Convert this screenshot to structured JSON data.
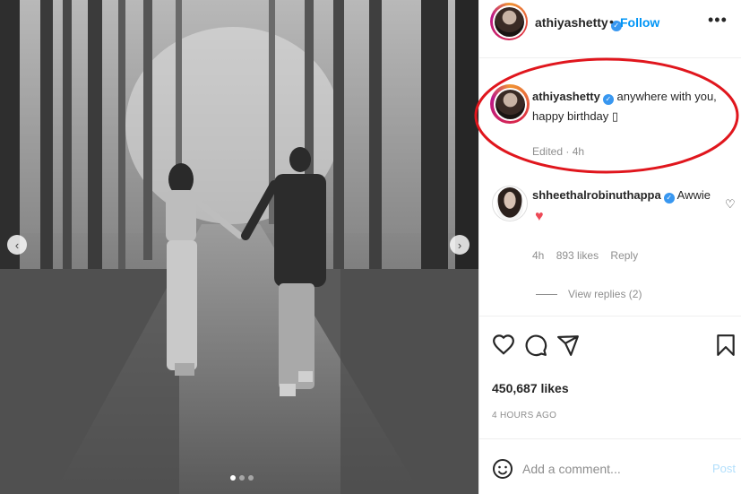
{
  "post": {
    "username": "athiyashetty",
    "follow_label": "Follow",
    "separator": "•",
    "more_label": "•••",
    "carousel_prev": "‹",
    "carousel_next": "›",
    "carousel_count": 3,
    "carousel_active": 1
  },
  "caption": {
    "username": "athiyashetty",
    "text": "anywhere with you, happy birthday ▯",
    "meta": "Edited · 4h"
  },
  "comment": {
    "username": "shheethalrobinuthappa",
    "text": "Awwie",
    "heart": "♥",
    "like_icon": "♡",
    "age": "4h",
    "likes": "893 likes",
    "reply": "Reply",
    "view_replies": "View replies (2)"
  },
  "stats": {
    "likes": "450,687 likes",
    "time": "4 HOURS AGO"
  },
  "composer": {
    "placeholder": "Add a comment...",
    "post_label": "Post"
  },
  "colors": {
    "accent": "#0095f6",
    "heart": "#ed4956",
    "annotation": "#e0161d"
  },
  "icons": [
    "verified-icon",
    "heart-icon",
    "comment-icon",
    "share-icon",
    "bookmark-icon",
    "emoji-icon",
    "more-icon"
  ]
}
